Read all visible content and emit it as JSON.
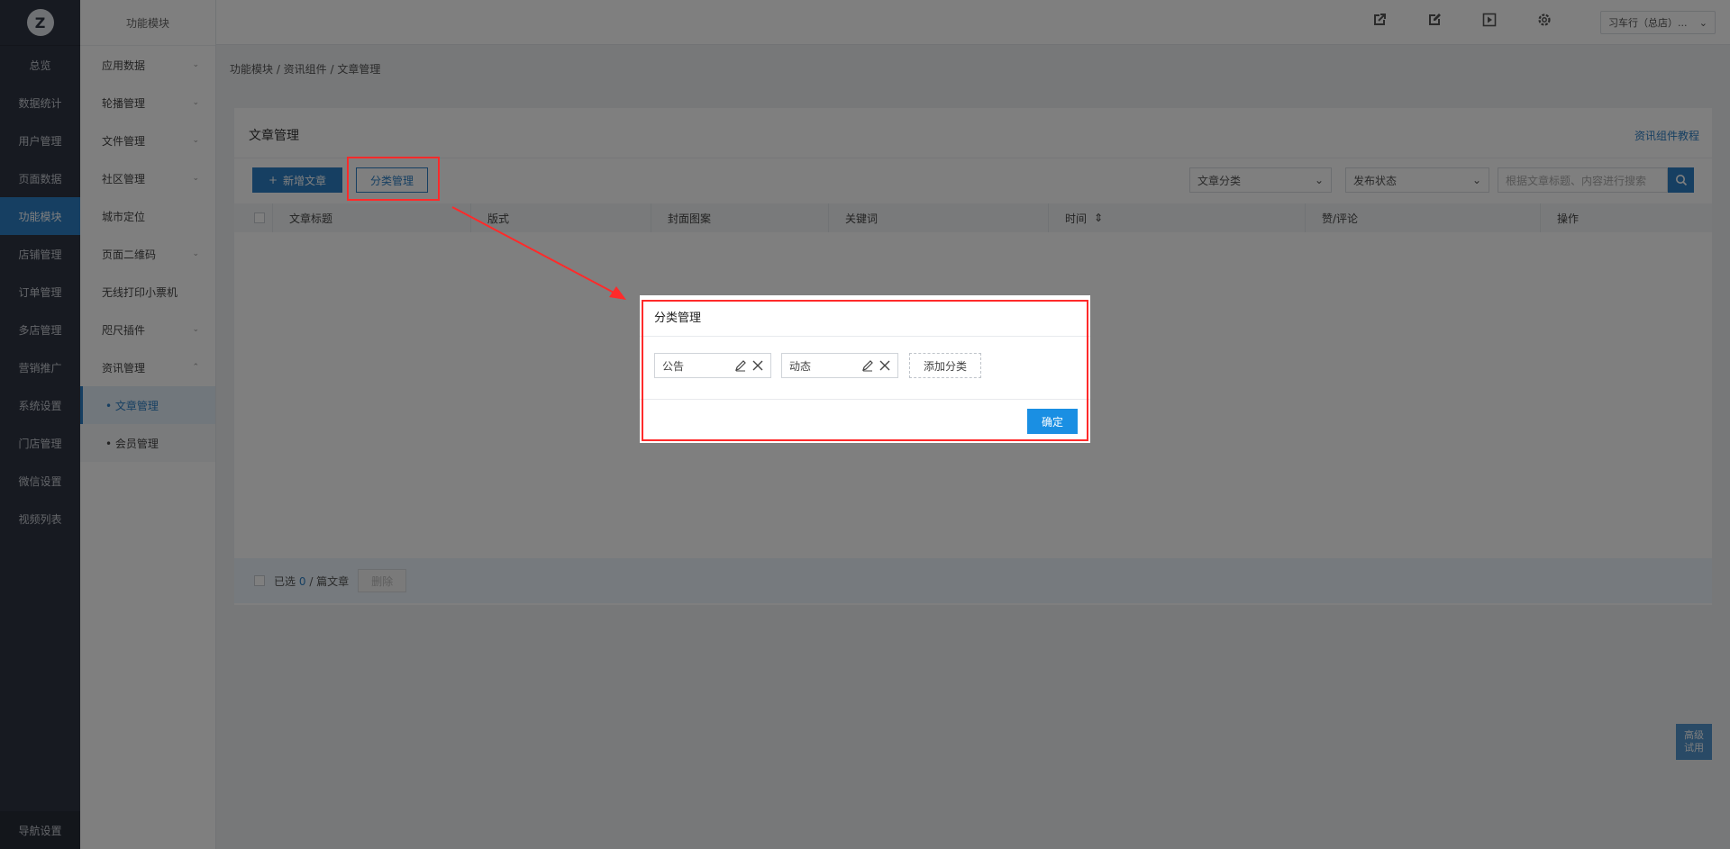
{
  "rail": {
    "logo": "Z",
    "items": [
      "总览",
      "数据统计",
      "用户管理",
      "页面数据",
      "功能模块",
      "店铺管理",
      "订单管理",
      "多店管理",
      "营销推广",
      "系统设置",
      "门店管理",
      "微信设置",
      "视频列表"
    ],
    "active_index": 4,
    "bottom": "导航设置"
  },
  "subnav": {
    "header": "功能模块",
    "items": [
      {
        "label": "应用数据",
        "chevron": "⌄"
      },
      {
        "label": "轮播管理",
        "chevron": "⌄"
      },
      {
        "label": "文件管理",
        "chevron": "⌄"
      },
      {
        "label": "社区管理",
        "chevron": "⌄"
      },
      {
        "label": "城市定位",
        "chevron": ""
      },
      {
        "label": "页面二维码",
        "chevron": "⌄"
      },
      {
        "label": "无线打印小票机",
        "chevron": ""
      },
      {
        "label": "咫尺插件",
        "chevron": "⌄"
      },
      {
        "label": "资讯管理",
        "chevron": "⌃"
      }
    ],
    "children": [
      {
        "label": "• 文章管理",
        "active": true
      },
      {
        "label": "• 会员管理",
        "active": false
      }
    ]
  },
  "topbar": {
    "icons": [
      "external-link-icon",
      "edit-icon",
      "play-icon",
      "settings-icon"
    ],
    "store_select": "习车行（总店）...",
    "store_chevron": "⌄"
  },
  "breadcrumb": "功能模块 / 资讯组件 / 文章管理",
  "card": {
    "title": "文章管理",
    "tutorial_link": "资讯组件教程",
    "add_button": "新增文章",
    "add_icon": "+",
    "category_button": "分类管理",
    "category_select": "文章分类",
    "status_select": "发布状态",
    "search_placeholder": "根据文章标题、内容进行搜索",
    "columns": [
      "文章标题",
      "版式",
      "封面图案",
      "关键词",
      "时间",
      "赞/评论",
      "操作"
    ],
    "sort_icon": "⇕",
    "footer_selected_prefix": "已选",
    "footer_selected_count": "0",
    "footer_selected_suffix": "/ 篇文章",
    "delete_button": "删除"
  },
  "float_button": [
    "高级",
    "试用"
  ],
  "modal": {
    "title": "分类管理",
    "tags": [
      "公告",
      "动态"
    ],
    "add_label": "添加分类",
    "confirm": "确定"
  },
  "colors": {
    "accent": "#2d7fc4",
    "highlight": "#ff2a2a",
    "rail_bg": "#2f3542"
  }
}
